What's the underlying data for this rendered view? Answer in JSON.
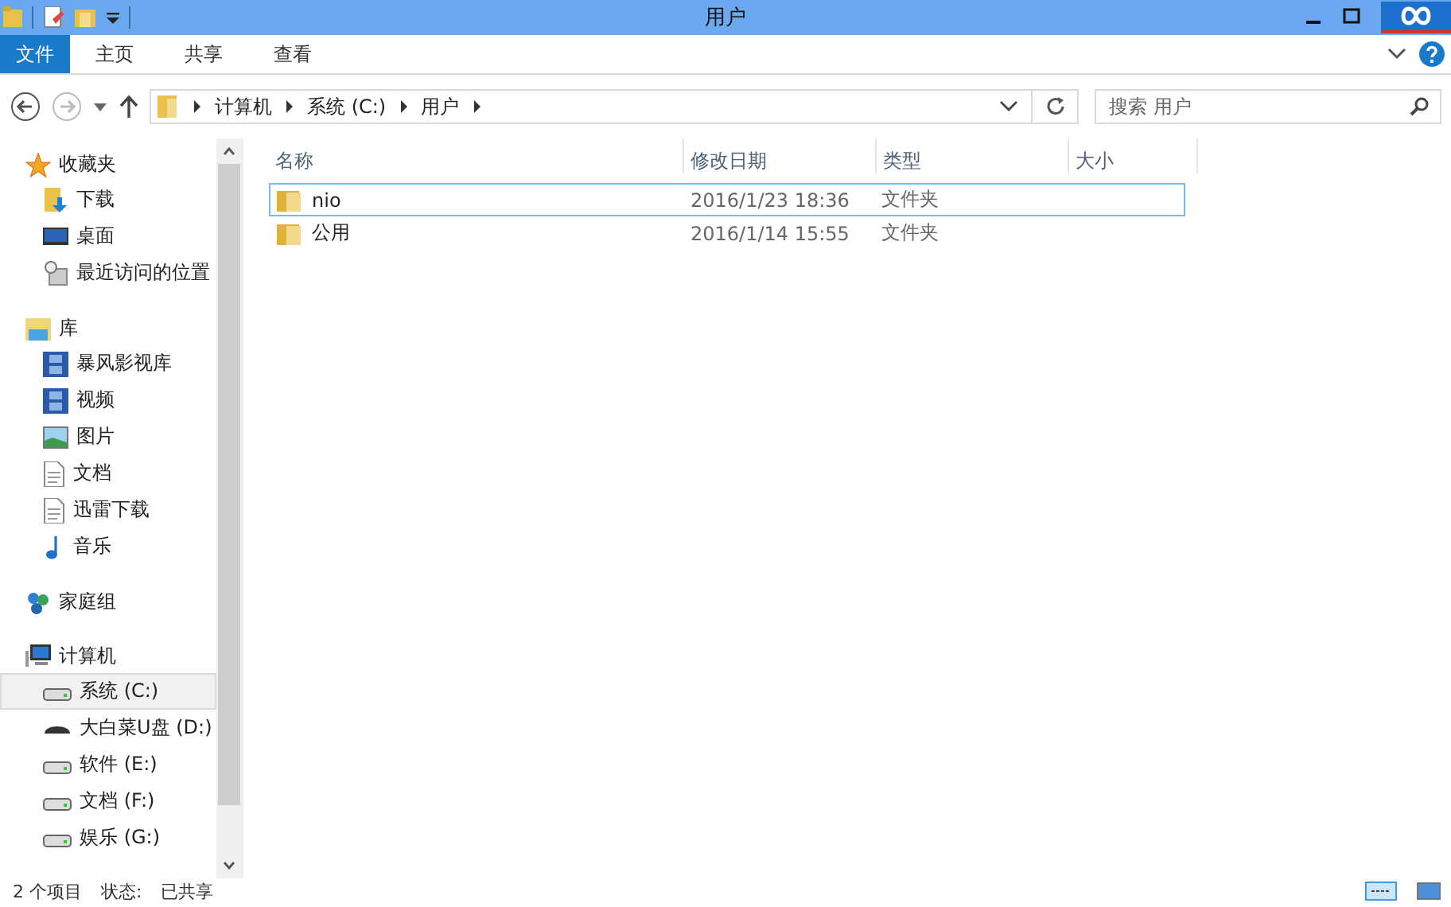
{
  "window": {
    "title": "用户"
  },
  "ribbon_tabs": [
    {
      "label": "文件",
      "kind": "file"
    },
    {
      "label": "主页",
      "kind": "tab"
    },
    {
      "label": "共享",
      "kind": "tab"
    },
    {
      "label": "查看",
      "kind": "tab"
    }
  ],
  "address_bar": {
    "crumbs": [
      "计算机",
      "系统 (C:)",
      "用户"
    ]
  },
  "search": {
    "placeholder": "搜索 用户"
  },
  "sidebar": {
    "groups": [
      {
        "label": "收藏夹",
        "items": [
          {
            "label": "下载",
            "selected": false
          },
          {
            "label": "桌面",
            "selected": false
          },
          {
            "label": "最近访问的位置",
            "selected": false
          }
        ]
      },
      {
        "label": "库",
        "items": [
          {
            "label": "暴风影视库",
            "selected": false
          },
          {
            "label": "视频",
            "selected": false
          },
          {
            "label": "图片",
            "selected": false
          },
          {
            "label": "文档",
            "selected": false
          },
          {
            "label": "迅雷下载",
            "selected": false
          },
          {
            "label": "音乐",
            "selected": false
          }
        ]
      },
      {
        "label": "家庭组"
      },
      {
        "label": "计算机",
        "items": [
          {
            "label": "系统 (C:)",
            "selected": true
          },
          {
            "label": "大白菜U盘 (D:)",
            "selected": false
          },
          {
            "label": "软件 (E:)",
            "selected": false
          },
          {
            "label": "文档 (F:)",
            "selected": false
          },
          {
            "label": "娱乐 (G:)",
            "selected": false
          }
        ]
      }
    ]
  },
  "table": {
    "columns": [
      "名称",
      "修改日期",
      "类型",
      "大小"
    ],
    "rows": [
      {
        "name": "nio",
        "modified": "2016/1/23 18:36",
        "type": "文件夹",
        "focused": true
      },
      {
        "name": "公用",
        "modified": "2016/1/14 15:55",
        "type": "文件夹",
        "focused": false
      }
    ]
  },
  "status_bar": {
    "items": [
      "2 个项目",
      "状态:",
      "已共享"
    ]
  }
}
